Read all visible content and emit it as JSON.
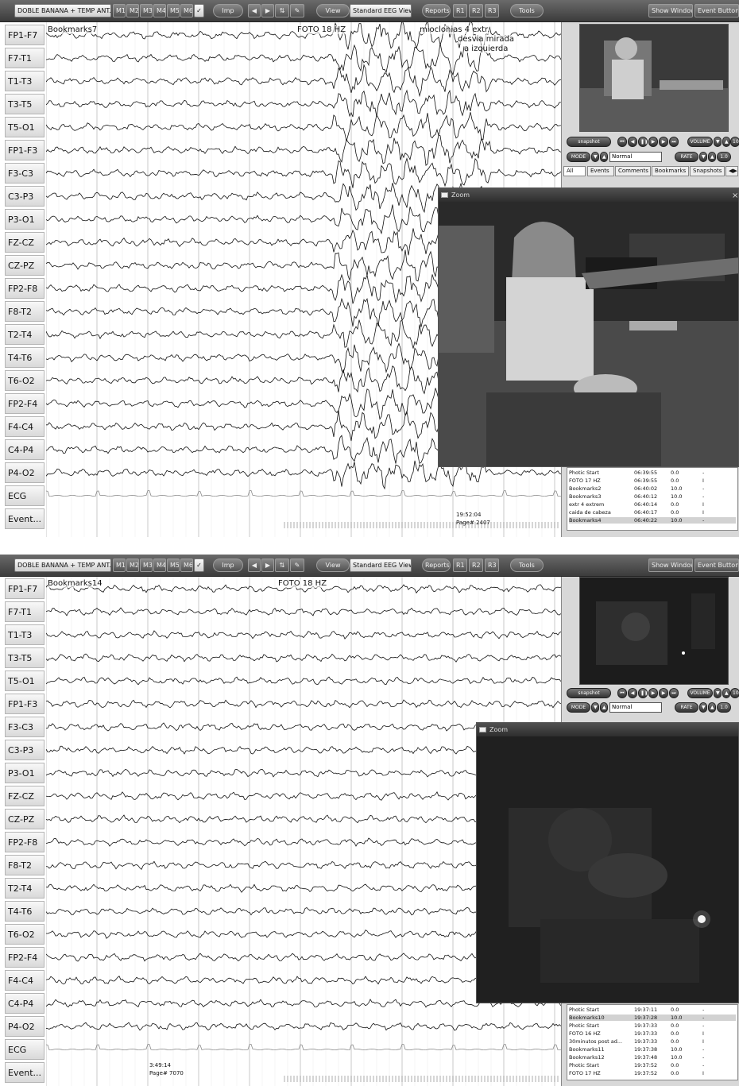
{
  "toolbar": {
    "montage": "DOBLE BANANA + TEMP ANT.",
    "m_buttons": [
      "M1",
      "M2",
      "M3",
      "M4",
      "M5",
      "M6"
    ],
    "imp": "Imp",
    "view": "View",
    "view_mode": "Standard EEG View",
    "reports": "Reports",
    "r_buttons": [
      "R1",
      "R2",
      "R3"
    ],
    "tools": "Tools",
    "show_window": "Show Window",
    "event_buttons": "Event Buttons"
  },
  "channels": [
    "FP1-F7",
    "F7-T1",
    "T1-T3",
    "T3-T5",
    "T5-O1",
    "FP1-F3",
    "F3-C3",
    "C3-P3",
    "P3-O1",
    "FZ-CZ",
    "CZ-PZ",
    "FP2-F8",
    "F8-T2",
    "T2-T4",
    "T4-T6",
    "T6-O2",
    "FP2-F4",
    "F4-C4",
    "C4-P4",
    "P4-O2",
    "ECG",
    "Event..."
  ],
  "video_controls": {
    "snapshot": "snapshot",
    "volume": "VOLUME",
    "volume_value": "10",
    "mode": "MODE",
    "mode_value": "Normal",
    "rate": "RATE",
    "rate_value": "1.0"
  },
  "event_tabs": [
    "All",
    "Events",
    "Comments",
    "Bookmarks",
    "Snapshots"
  ],
  "zoom_title": "Zoom",
  "panels": [
    {
      "annotations": {
        "bookmark": "Bookmarks7",
        "photic": "FOTO 18 HZ",
        "note_line1": "mioclonias 4 extr.",
        "note_line2": "desvia mirada",
        "note_line3": "a izquierda"
      },
      "time_stamp": "19:52:04",
      "page_label": "Page# 2407",
      "events": [
        {
          "name": "Photic Start",
          "time": "06:39:55",
          "dur": "0.0",
          "flag": "-"
        },
        {
          "name": "FOTO 17 HZ",
          "time": "06:39:55",
          "dur": "0.0",
          "flag": "I"
        },
        {
          "name": "Bookmarks2",
          "time": "06:40:02",
          "dur": "10.0",
          "flag": "-"
        },
        {
          "name": "Bookmarks3",
          "time": "06:40:12",
          "dur": "10.0",
          "flag": "-"
        },
        {
          "name": "extr 4 extrem",
          "time": "06:40:14",
          "dur": "0.0",
          "flag": "I"
        },
        {
          "name": "caida de cabeza",
          "time": "06:40:17",
          "dur": "0.0",
          "flag": "I"
        },
        {
          "name": "Bookmarks4",
          "time": "06:40:22",
          "dur": "10.0",
          "flag": "-"
        }
      ]
    },
    {
      "annotations": {
        "bookmark": "Bookmarks14",
        "photic": "FOTO 18 HZ"
      },
      "time_stamp": "3:49:14",
      "page_label": "Page# 7070",
      "events": [
        {
          "name": "Photic Start",
          "time": "19:37:11",
          "dur": "0.0",
          "flag": "-"
        },
        {
          "name": "Bookmarks10",
          "time": "19:37:28",
          "dur": "10.0",
          "flag": "-"
        },
        {
          "name": "Photic Start",
          "time": "19:37:33",
          "dur": "0.0",
          "flag": "-"
        },
        {
          "name": "FOTO 16 HZ",
          "time": "19:37:33",
          "dur": "0.0",
          "flag": "I"
        },
        {
          "name": "30minutos post ad...",
          "time": "19:37:33",
          "dur": "0.0",
          "flag": "I"
        },
        {
          "name": "Bookmarks11",
          "time": "19:37:38",
          "dur": "10.0",
          "flag": "-"
        },
        {
          "name": "Bookmarks12",
          "time": "19:37:48",
          "dur": "10.0",
          "flag": "-"
        },
        {
          "name": "Photic Start",
          "time": "19:37:52",
          "dur": "0.0",
          "flag": "-"
        },
        {
          "name": "FOTO 17 HZ",
          "time": "19:37:52",
          "dur": "0.0",
          "flag": "I"
        }
      ]
    }
  ],
  "colors": {
    "toolbar": "#4a4a4a",
    "trace": "#111111",
    "ecg_trace": "#8a8a8a",
    "grid": "#c8c8c8",
    "panel_bg": "#d8d8d8"
  }
}
